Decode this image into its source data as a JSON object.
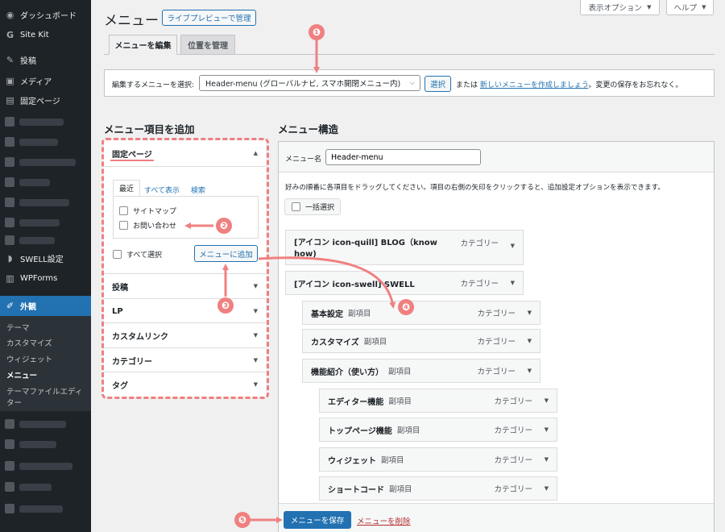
{
  "sidebar": {
    "items": [
      {
        "label": "ダッシュボード",
        "icon": "dashboard-icon"
      },
      {
        "label": "Site Kit",
        "icon": "google-icon"
      },
      {
        "label": "投稿",
        "icon": "pin-icon"
      },
      {
        "label": "メディア",
        "icon": "media-icon"
      },
      {
        "label": "固定ページ",
        "icon": "page-icon"
      },
      {
        "label": "SWELL設定",
        "icon": "swell-icon"
      },
      {
        "label": "WPForms",
        "icon": "wpforms-icon"
      },
      {
        "label": "外観",
        "icon": "brush-icon"
      }
    ],
    "submenu": [
      "テーマ",
      "カスタマイズ",
      "ウィジェット",
      "メニュー",
      "テーマファイルエディ",
      "ター"
    ]
  },
  "header": {
    "title": "メニュー",
    "live_preview": "ライブプレビューで管理",
    "screen_options": "表示オプション",
    "help": "ヘルプ"
  },
  "tabs": [
    "メニューを編集",
    "位置を管理"
  ],
  "select_menu": {
    "label": "編集するメニューを選択:",
    "value": "Header-menu (グローバルナビ, スマホ開閉メニュー内)",
    "button": "選択",
    "or_text": "または",
    "create_link": "新しいメニューを作成しましょう",
    "tail": "。変更の保存をお忘れなく。"
  },
  "add_items": {
    "heading": "メニュー項目を追加",
    "open_section": "固定ページ",
    "subtabs": [
      "最近",
      "すべて表示",
      "検索"
    ],
    "pages": [
      "サイトマップ",
      "お問い合わせ"
    ],
    "select_all": "すべて選択",
    "add_button": "メニューに追加",
    "sections": [
      "投稿",
      "LP",
      "カスタムリンク",
      "カテゴリー",
      "タグ"
    ]
  },
  "structure": {
    "heading": "メニュー構造",
    "name_label": "メニュー名",
    "name_value": "Header-menu",
    "instructions": "好みの順番に各項目をドラッグしてください。項目の右側の矢印をクリックすると、追加設定オプションを表示できます。",
    "bulk_select": "一括選択",
    "items": [
      {
        "title": "[アイコン icon-quill] BLOG（know",
        "title2": "how)",
        "sub": "",
        "type": "カテゴリー"
      },
      {
        "title": "[アイコン icon-swell] SWELL",
        "sub": "",
        "type": "カテゴリー"
      },
      {
        "title": "基本設定",
        "sub": "副項目",
        "type": "カテゴリー"
      },
      {
        "title": "カスタマイズ",
        "sub": "副項目",
        "type": "カテゴリー"
      },
      {
        "title": "機能紹介（使い方）",
        "sub": "副項目",
        "type": "カテゴリー"
      },
      {
        "title": "エディター機能",
        "sub": "副項目",
        "type": "カテゴリー"
      },
      {
        "title": "トップページ機能",
        "sub": "副項目",
        "type": "カテゴリー"
      },
      {
        "title": "ウィジェット",
        "sub": "副項目",
        "type": "カテゴリー"
      },
      {
        "title": "ショートコード",
        "sub": "副項目",
        "type": "カテゴリー"
      }
    ],
    "save_button": "メニューを保存",
    "delete_link": "メニューを削除"
  },
  "annotations": [
    "❶",
    "❷",
    "❸",
    "❹",
    "❺"
  ],
  "colors": {
    "accent": "#2271b1",
    "sidebar": "#1d2327",
    "annotation": "#f08080"
  }
}
